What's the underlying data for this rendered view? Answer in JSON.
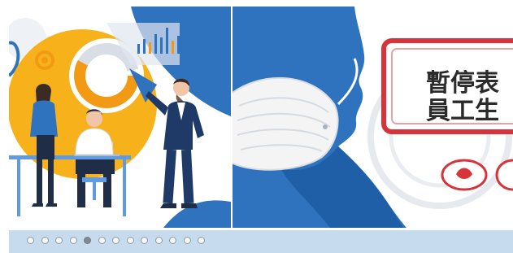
{
  "carousel": {
    "slides": [
      {
        "name": "business-illustration"
      },
      {
        "name": "mask-notice"
      }
    ],
    "dot_count": 13,
    "active_index": 4
  },
  "notice": {
    "line1": "暫停表",
    "line2": "員工生"
  },
  "colors": {
    "blue": "#2f73bf",
    "yellow": "#f7b21b",
    "red_stamp": "#d8333a",
    "dots_bar": "#c7dbef"
  }
}
